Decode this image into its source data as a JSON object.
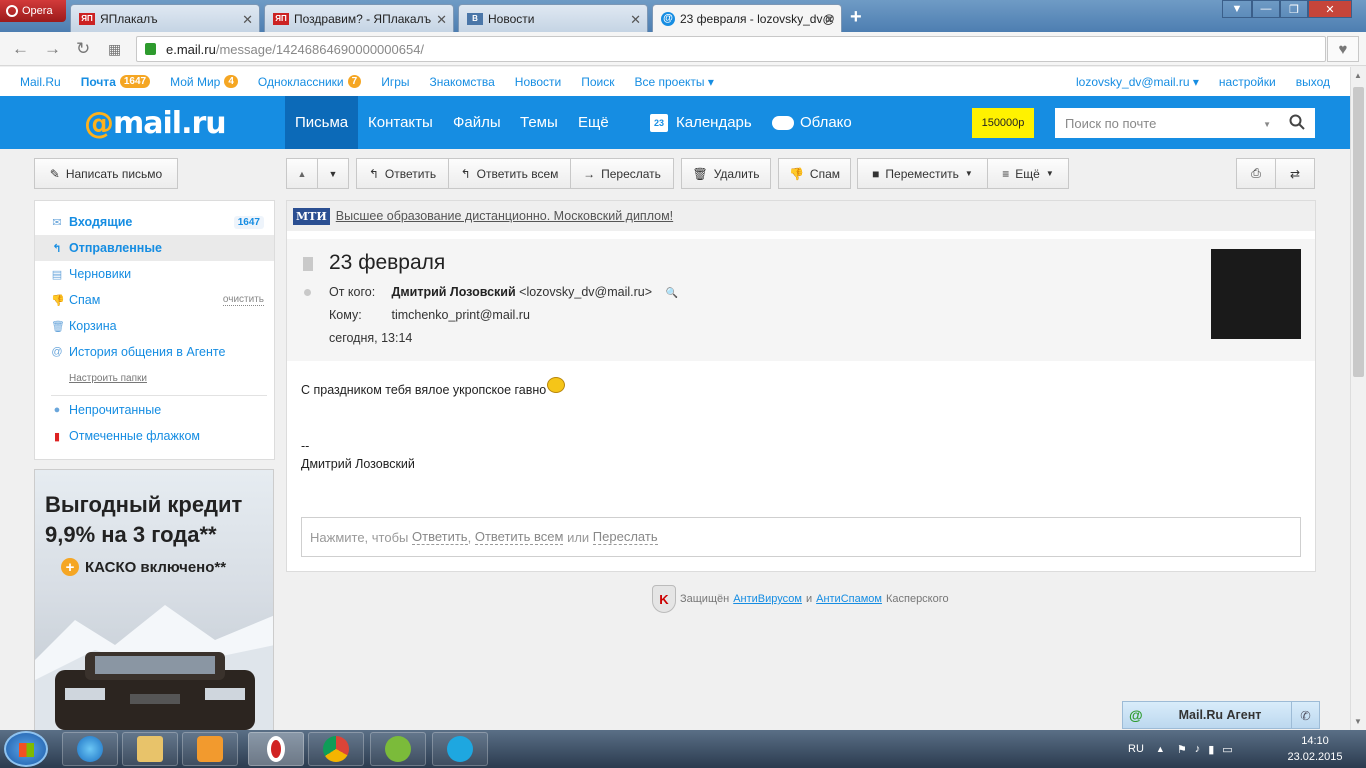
{
  "browser": {
    "opera_label": "Opera",
    "tabs": [
      {
        "label": "ЯПлакалъ",
        "icon": "yaplakal-favicon"
      },
      {
        "label": "Поздравим? - ЯПлакалъ",
        "icon": "yaplakal-favicon"
      },
      {
        "label": "Новости",
        "icon": "vk-favicon"
      },
      {
        "label": "23 февраля - lozovsky_dv@",
        "icon": "mailru-favicon"
      }
    ],
    "url_host": "e.mail.ru",
    "url_path": "/message/14246864690000000654/"
  },
  "portal": {
    "links": [
      {
        "label": "Mail.Ru"
      },
      {
        "label": "Почта",
        "badge": "1647"
      },
      {
        "label": "Мой Мир",
        "badge": "4"
      },
      {
        "label": "Одноклассники",
        "badge": "7"
      },
      {
        "label": "Игры"
      },
      {
        "label": "Знакомства"
      },
      {
        "label": "Новости"
      },
      {
        "label": "Поиск"
      },
      {
        "label": "Все проекты ▾"
      }
    ],
    "user_email": "lozovsky_dv@mail.ru ▾",
    "settings": "настройки",
    "logout": "выход"
  },
  "header": {
    "logo_at": "@",
    "logo_text": "mail.ru",
    "nav": [
      "Письма",
      "Контакты",
      "Файлы",
      "Темы",
      "Ещё"
    ],
    "calendar_day": "23",
    "calendar_label": "Календарь",
    "cloud_label": "Облако",
    "balance": "150000р",
    "search_placeholder": "Поиск по почте"
  },
  "toolbar": {
    "compose": "Написать письмо",
    "reply": "Ответить",
    "reply_all": "Ответить всем",
    "forward": "Переслать",
    "delete": "Удалить",
    "spam": "Спам",
    "move": "Переместить",
    "more": "Ещё"
  },
  "sidebar": {
    "folders": [
      {
        "label": "Входящие",
        "count": "1647",
        "icon": "envelope-icon"
      },
      {
        "label": "Отправленные",
        "icon": "reply-arrow-icon"
      },
      {
        "label": "Черновики",
        "icon": "draft-icon"
      },
      {
        "label": "Спам",
        "action": "очистить",
        "icon": "thumb-down-icon"
      },
      {
        "label": "Корзина",
        "icon": "trash-icon"
      },
      {
        "label": "История общения в Агенте",
        "icon": "at-icon"
      }
    ],
    "configure": "Настроить папки",
    "filters": [
      {
        "label": "Непрочитанные",
        "icon": "unread-dot-icon"
      },
      {
        "label": "Отмеченные флажком",
        "icon": "flag-icon"
      }
    ]
  },
  "ad": {
    "line1": "Выгодный кредит",
    "line2": "9,9% на 3 года**",
    "line3": "КАСКО включено**"
  },
  "message": {
    "ad_brand": "МТИ",
    "ad_text": "Высшее образование дистанционно. Московский диплом!",
    "subject": "23 февраля",
    "from_label": "От кого:",
    "from_name": "Дмитрий Лозовский",
    "from_email": "<lozovsky_dv@mail.ru>",
    "to_label": "Кому:",
    "to": "timchenko_print@mail.ru",
    "date": "сегодня, 13:14",
    "body": "С праздником тебя вялое укропское гавно",
    "sig_dash": "--",
    "sig_name": "Дмитрий Лозовский",
    "reply_prompt": "Нажмите, чтобы",
    "reply_link": "Ответить",
    "reply_all_link": "Ответить всем",
    "reply_or": "или",
    "forward_link": "Переслать"
  },
  "footer": {
    "protected": "Защищён",
    "antivirus": "АнтиВирусом",
    "and": "и",
    "antispam": "АнтиСпамом",
    "kaspersky": "Касперского"
  },
  "agent": {
    "title": "Mail.Ru Агент"
  },
  "taskbar": {
    "lang": "RU",
    "time": "14:10",
    "date": "23.02.2015"
  }
}
